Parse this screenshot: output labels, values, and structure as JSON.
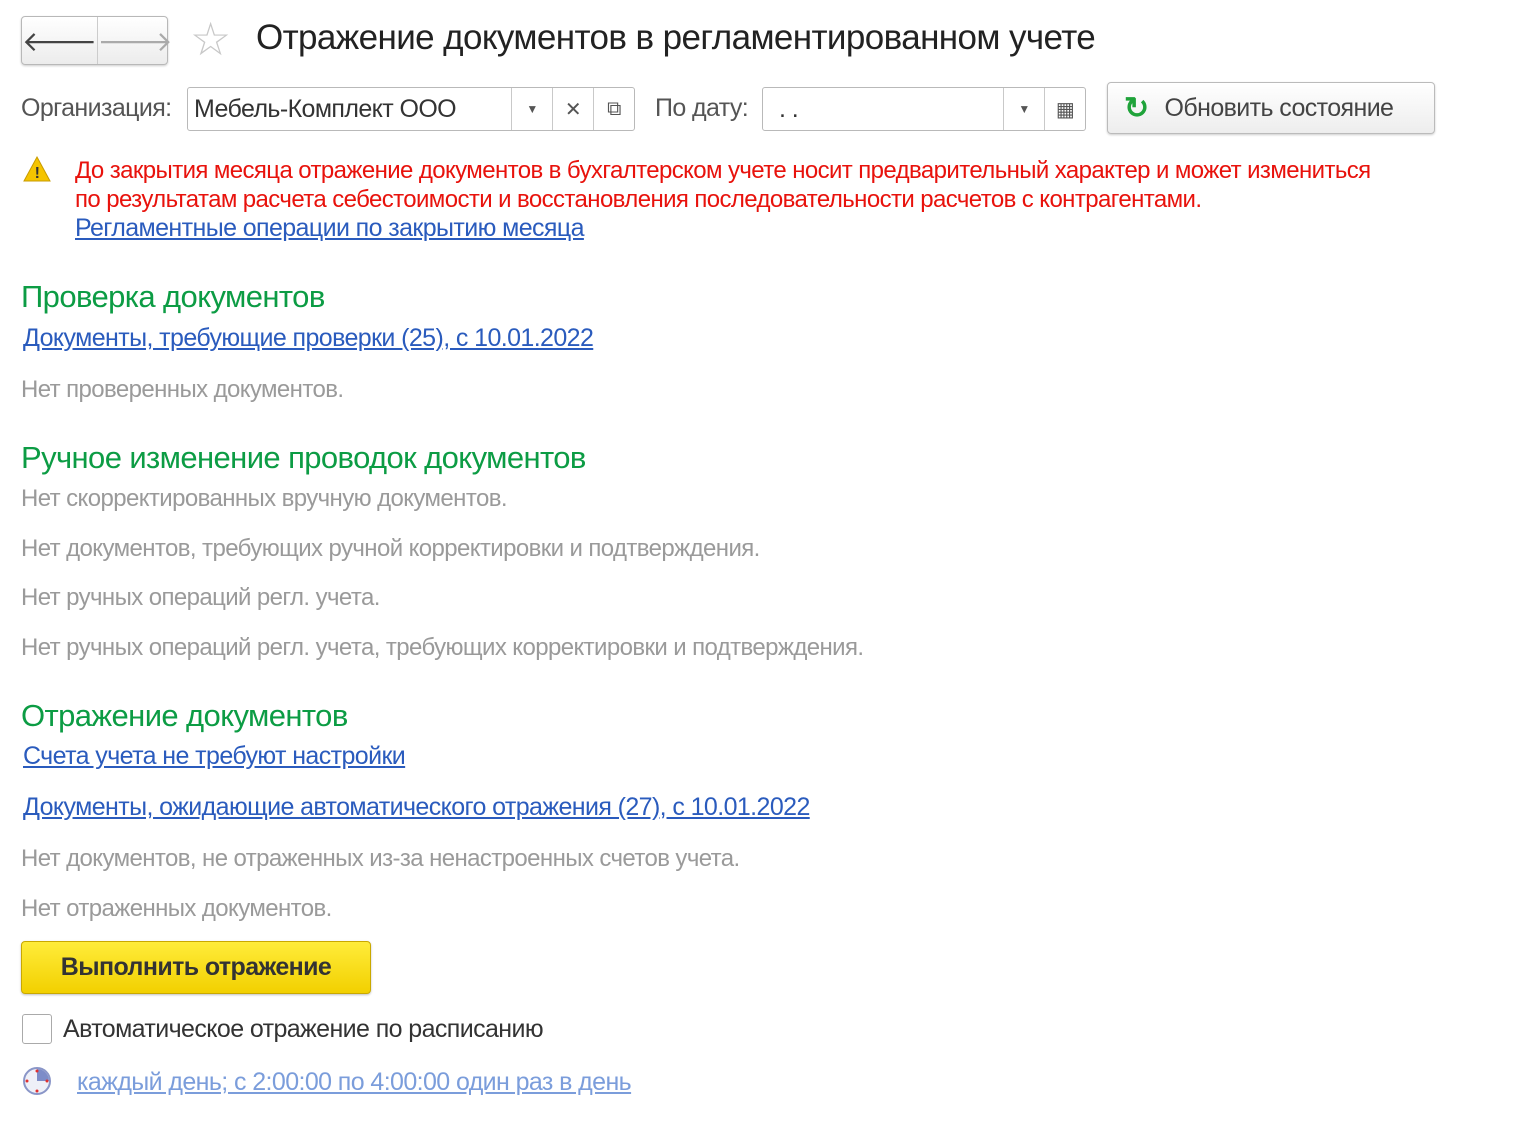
{
  "header": {
    "back_icon": "arrow-left-icon",
    "forward_icon": "arrow-right-icon",
    "favorite_icon": "star-icon",
    "title": "Отражение документов в регламентированном учете"
  },
  "filters": {
    "org_label": "Организация:",
    "org_value": "Мебель-Комплект ООО",
    "date_label": "По дату:",
    "date_value": ". .",
    "refresh_label": "Обновить состояние"
  },
  "warning": {
    "line1": "До закрытия месяца отражение документов в бухгалтерском учете носит предварительный характер и может измениться",
    "line2": "по результатам расчета себестоимости и восстановления последовательности расчетов с контрагентами.",
    "link": "Регламентные операции по закрытию месяца",
    "color": "#e8120c"
  },
  "check": {
    "title": "Проверка документов",
    "link": "Документы, требующие проверки (25), с 10.01.2022",
    "note": "Нет проверенных документов."
  },
  "manual": {
    "title": "Ручное изменение проводок документов",
    "notes": [
      "Нет скорректированных вручную документов.",
      "Нет документов, требующих ручной корректировки и подтверждения.",
      "Нет ручных операций регл. учета.",
      "Нет ручных операций регл. учета, требующих корректировки и подтверждения."
    ]
  },
  "reflect": {
    "title": "Отражение документов",
    "link1": "Счета учета не требуют настройки",
    "link2": "Документы, ожидающие автоматического отражения (27), с 10.01.2022",
    "notes": [
      "Нет документов, не отраженных из-за ненастроенных счетов учета.",
      "Нет отраженных документов."
    ],
    "button": "Выполнить отражение"
  },
  "schedule": {
    "checkbox_label": "Автоматическое отражение по расписанию",
    "checked": false,
    "link": "каждый день; с 2:00:00 по 4:00:00 один раз в день"
  },
  "colors": {
    "section": "#0c9c44",
    "link": "#2a5bbd",
    "accent_button": "#f5d400"
  }
}
